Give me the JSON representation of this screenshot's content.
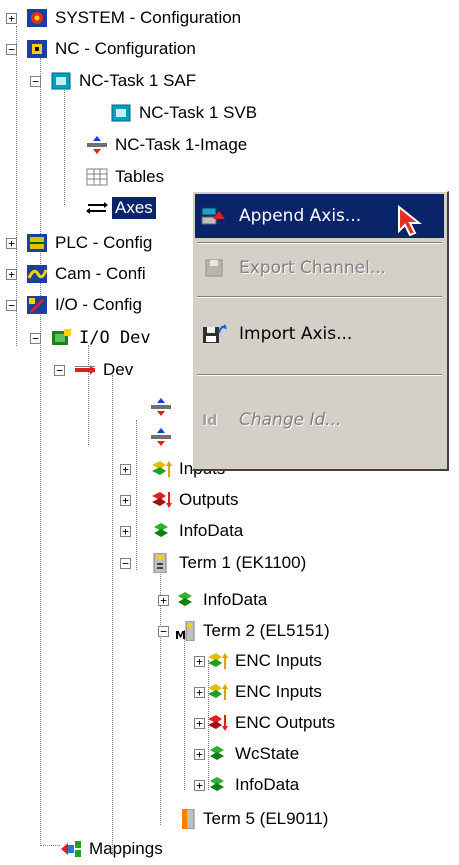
{
  "tree": {
    "system": "SYSTEM - Configuration",
    "nc": "NC - Configuration",
    "nc_task_saf": "NC-Task 1 SAF",
    "nc_task_svb": "NC-Task 1 SVB",
    "nc_task_image": "NC-Task 1-Image",
    "tables": "Tables",
    "axes": "Axes",
    "plc": "PLC - Config",
    "cam": "Cam - Confi",
    "io": "I/O - Config",
    "io_devices": "I/O Dev",
    "device": "Dev",
    "inputs": "Inputs",
    "outputs": "Outputs",
    "infodata": "InfoData",
    "term1": "Term 1 (EK1100)",
    "term1_infodata": "InfoData",
    "term2": "Term 2 (EL5151)",
    "enc_inputs_1": "ENC Inputs",
    "enc_inputs_2": "ENC Inputs",
    "enc_outputs": "ENC Outputs",
    "wcstate": "WcState",
    "term2_infodata": "InfoData",
    "term5": "Term 5 (EL9011)",
    "mappings": "Mappings"
  },
  "context_menu": {
    "append_axis": "Append Axis...",
    "export_channel": "Export Channel...",
    "import_axis": "Import Axis...",
    "change_id": "Change Id..."
  },
  "colors": {
    "selection": "#0a246a",
    "menu_bg": "#d4d0c8",
    "disabled_text": "#808080"
  }
}
